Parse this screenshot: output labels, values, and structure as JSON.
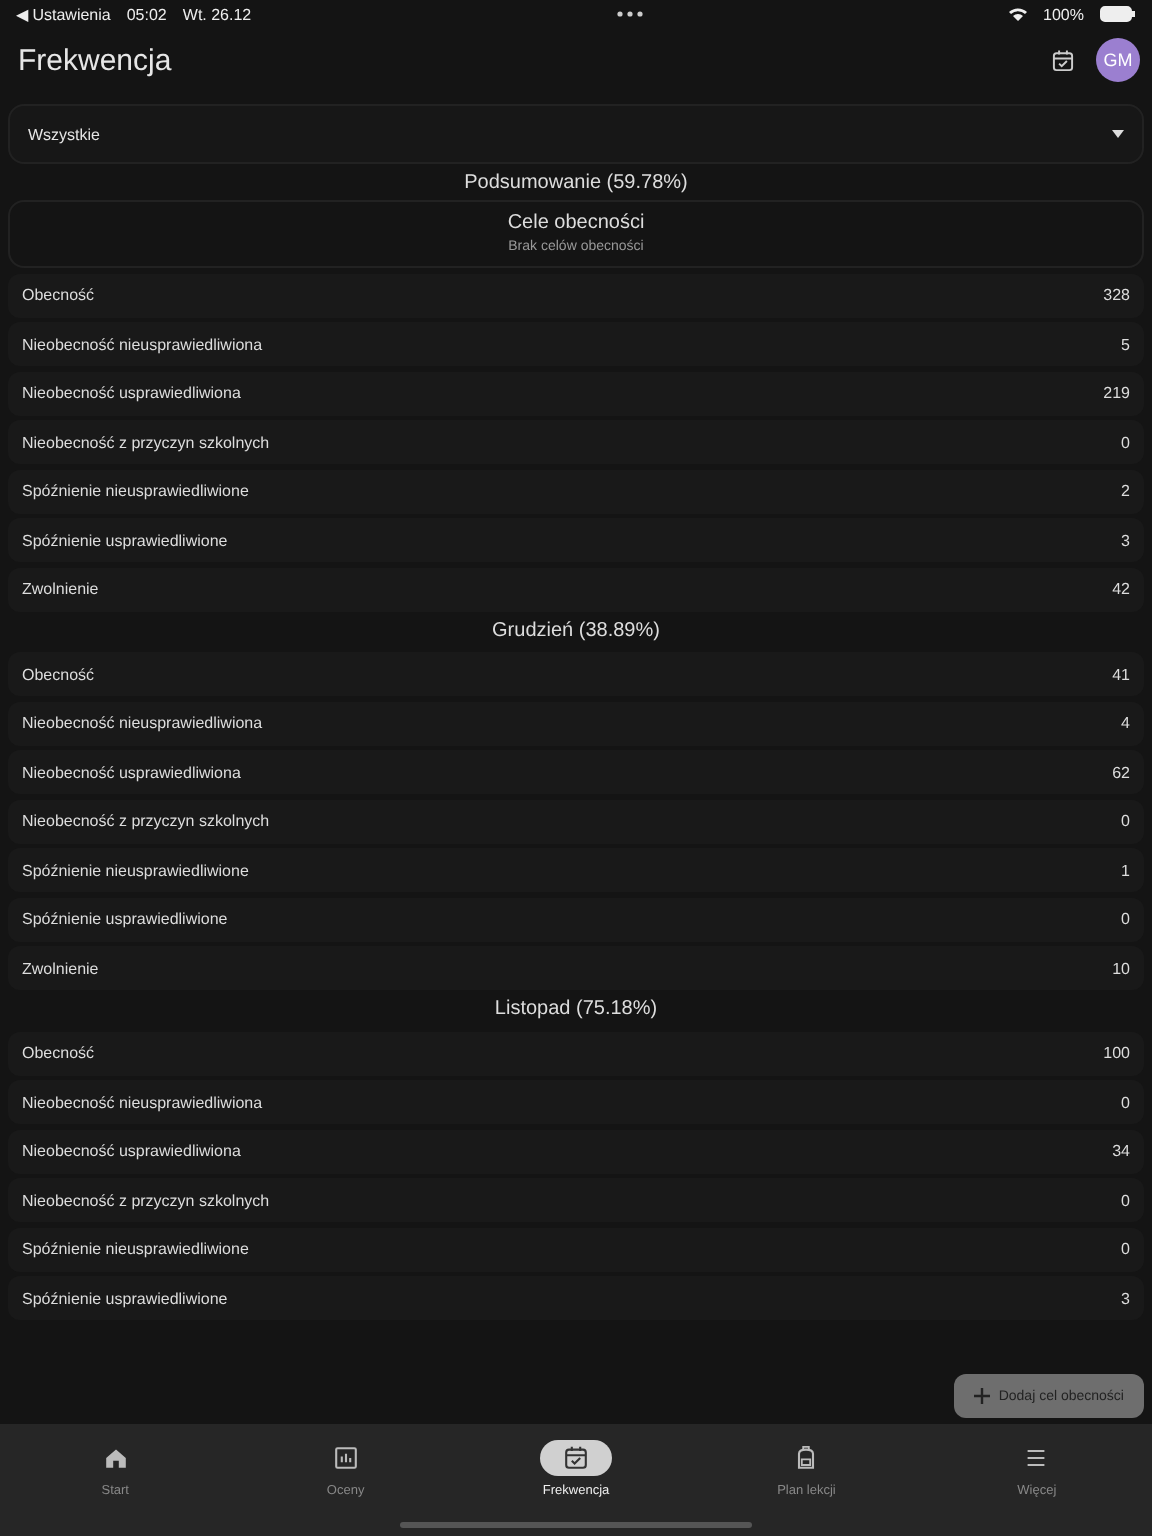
{
  "status_bar": {
    "back": "◀ Ustawienia",
    "time": "05:02",
    "date": "Wt. 26.12",
    "battery": "100%"
  },
  "header": {
    "title": "Frekwencja",
    "avatar": "GM"
  },
  "filter": {
    "value": "Wszystkie"
  },
  "sections": [
    {
      "title": "Podsumowanie (59.78%)",
      "goals": {
        "title": "Cele obecności",
        "empty": "Brak celów obecności"
      },
      "rows": [
        {
          "label": "Obecność",
          "value": "328"
        },
        {
          "label": "Nieobecność nieusprawiedliwiona",
          "value": "5"
        },
        {
          "label": "Nieobecność usprawiedliwiona",
          "value": "219"
        },
        {
          "label": "Nieobecność z przyczyn szkolnych",
          "value": "0"
        },
        {
          "label": "Spóźnienie nieusprawiedliwione",
          "value": "2"
        },
        {
          "label": "Spóźnienie usprawiedliwione",
          "value": "3"
        },
        {
          "label": "Zwolnienie",
          "value": "42"
        }
      ]
    },
    {
      "title": "Grudzień (38.89%)",
      "rows": [
        {
          "label": "Obecność",
          "value": "41"
        },
        {
          "label": "Nieobecność nieusprawiedliwiona",
          "value": "4"
        },
        {
          "label": "Nieobecność usprawiedliwiona",
          "value": "62"
        },
        {
          "label": "Nieobecność z przyczyn szkolnych",
          "value": "0"
        },
        {
          "label": "Spóźnienie nieusprawiedliwione",
          "value": "1"
        },
        {
          "label": "Spóźnienie usprawiedliwione",
          "value": "0"
        },
        {
          "label": "Zwolnienie",
          "value": "10"
        }
      ]
    },
    {
      "title": "Listopad (75.18%)",
      "rows": [
        {
          "label": "Obecność",
          "value": "100"
        },
        {
          "label": "Nieobecność nieusprawiedliwiona",
          "value": "0"
        },
        {
          "label": "Nieobecność usprawiedliwiona",
          "value": "34"
        },
        {
          "label": "Nieobecność z przyczyn szkolnych",
          "value": "0"
        },
        {
          "label": "Spóźnienie nieusprawiedliwione",
          "value": "0"
        },
        {
          "label": "Spóźnienie usprawiedliwione",
          "value": "3"
        }
      ]
    }
  ],
  "fab": {
    "label": "Dodaj cel obecności"
  },
  "nav": [
    {
      "kind": "home",
      "label": "Start",
      "selected": false
    },
    {
      "kind": "chart",
      "label": "Oceny",
      "selected": false
    },
    {
      "kind": "calendar",
      "label": "Frekwencja",
      "selected": true
    },
    {
      "kind": "bag",
      "label": "Plan lekcji",
      "selected": false
    },
    {
      "kind": "menu",
      "label": "Więcej",
      "selected": false
    }
  ]
}
